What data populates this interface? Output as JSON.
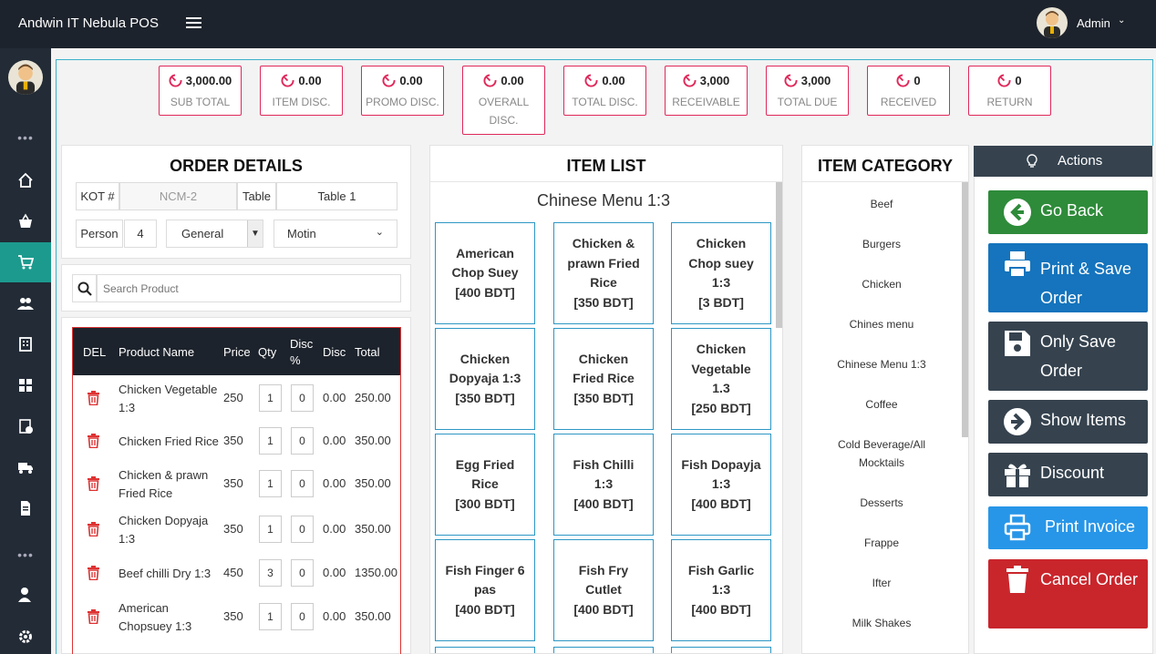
{
  "app": {
    "title": "Andwin IT Nebula POS",
    "user": "Admin"
  },
  "summary": [
    {
      "value": "3,000.00",
      "label": "SUB TOTAL"
    },
    {
      "value": "0.00",
      "label": "ITEM DISC."
    },
    {
      "value": "0.00",
      "label": "PROMO DISC."
    },
    {
      "value": "0.00",
      "label": "OVERALL DISC."
    },
    {
      "value": "0.00",
      "label": "TOTAL DISC."
    },
    {
      "value": "3,000",
      "label": "RECEIVABLE"
    },
    {
      "value": "3,000",
      "label": "TOTAL DUE"
    },
    {
      "value": "0",
      "label": "RECEIVED"
    },
    {
      "value": "0",
      "label": "RETURN"
    }
  ],
  "order": {
    "title": "ORDER DETAILS",
    "kot_label": "KOT #",
    "kot_value": "NCM-2",
    "table_label": "Table",
    "table_value": "Table 1",
    "person_label": "Person",
    "person_value": "4",
    "type_value": "General",
    "waiter_value": "Motin",
    "search_placeholder": "Search Product",
    "columns": [
      "DEL",
      "Product Name",
      "Price",
      "Qty",
      "Disc %",
      "Disc",
      "Total"
    ],
    "rows": [
      {
        "name": "Chicken Vegetable 1:3",
        "price": "250",
        "qty": "1",
        "discp": "0",
        "disc": "0.00",
        "total": "250.00"
      },
      {
        "name": "Chicken Fried Rice",
        "price": "350",
        "qty": "1",
        "discp": "0",
        "disc": "0.00",
        "total": "350.00"
      },
      {
        "name": "Chicken & prawn Fried Rice",
        "price": "350",
        "qty": "1",
        "discp": "0",
        "disc": "0.00",
        "total": "350.00"
      },
      {
        "name": "Chicken Dopyaja 1:3",
        "price": "350",
        "qty": "1",
        "discp": "0",
        "disc": "0.00",
        "total": "350.00"
      },
      {
        "name": "Beef chilli Dry 1:3",
        "price": "450",
        "qty": "3",
        "discp": "0",
        "disc": "0.00",
        "total": "1350.00"
      },
      {
        "name": "American Chopsuey 1:3",
        "price": "350",
        "qty": "1",
        "discp": "0",
        "disc": "0.00",
        "total": "350.00"
      }
    ]
  },
  "items": {
    "title": "ITEM LIST",
    "category": "Chinese Menu 1:3",
    "list": [
      {
        "name": "American Chop Suey",
        "price": "[400 BDT]"
      },
      {
        "name": "Chicken & prawn Fried Rice",
        "price": "[350 BDT]"
      },
      {
        "name": "Chicken Chop suey 1:3",
        "price": "[3 BDT]"
      },
      {
        "name": "Chicken Dopyaja 1:3",
        "price": "[350 BDT]"
      },
      {
        "name": "Chicken Fried Rice",
        "price": "[350 BDT]"
      },
      {
        "name": "Chicken Vegetable 1.3",
        "price": "[250 BDT]"
      },
      {
        "name": "Egg Fried Rice",
        "price": "[300 BDT]"
      },
      {
        "name": "Fish Chilli 1:3",
        "price": "[400 BDT]"
      },
      {
        "name": "Fish Dopayja 1:3",
        "price": "[400 BDT]"
      },
      {
        "name": "Fish Finger 6 pas",
        "price": "[400 BDT]"
      },
      {
        "name": "Fish Fry Cutlet",
        "price": "[400 BDT]"
      },
      {
        "name": "Fish Garlic 1:3",
        "price": "[400 BDT]"
      }
    ]
  },
  "categories": {
    "title": "ITEM CATEGORY",
    "list": [
      "Beef",
      "Burgers",
      "Chicken",
      "Chines menu",
      "Chinese Menu 1:3",
      "Coffee",
      "Cold Beverage/All Mocktails",
      "Desserts",
      "Frappe",
      "Ifter",
      "Milk Shakes"
    ]
  },
  "actions": {
    "title": "Actions",
    "buttons": [
      {
        "label": "Go Back",
        "color": "#2e8b3a"
      },
      {
        "label": "Print & Save Order",
        "color": "#1574bd"
      },
      {
        "label": "Only Save Order",
        "color": "#36434f"
      },
      {
        "label": "Show Items",
        "color": "#36434f"
      },
      {
        "label": "Discount",
        "color": "#36434f"
      },
      {
        "label": "Print Invoice",
        "color": "#2796e8"
      },
      {
        "label": "Cancel Order",
        "color": "#c9262c"
      }
    ]
  },
  "colors": {
    "accent": "#1c9a8e",
    "card_border": "#e0285a",
    "item_border": "#2d97c4",
    "dark": "#1d232c"
  }
}
